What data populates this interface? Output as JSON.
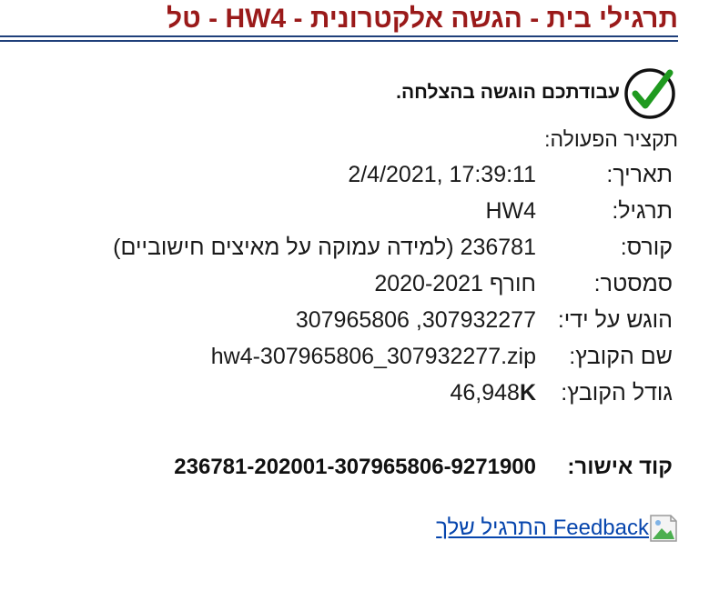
{
  "header": {
    "title": "תרגילי בית - הגשה אלקטרונית - HW4 - טל"
  },
  "success": {
    "icon": "check-circle-icon",
    "message": "עבודתכם הוגשה בהצלחה."
  },
  "summary": {
    "title": "תקציר הפעולה:",
    "rows": [
      {
        "label": "תאריך:",
        "value": "2/4/2021, 17:39:11"
      },
      {
        "label": "תרגיל:",
        "value": "HW4"
      },
      {
        "label": "קורס:",
        "value": "236781 (למידה עמוקה על מאיצים חישוביים)"
      },
      {
        "label": "סמסטר:",
        "value": "חורף 2020-2021"
      },
      {
        "label": "הוגש על ידי:",
        "value": "307965806 ,307932277"
      },
      {
        "label": "שם הקובץ:",
        "value": "hw4-307965806_307932277.zip"
      }
    ],
    "file_size": {
      "label": "גודל הקובץ:",
      "value": "46,948",
      "unit": "K"
    }
  },
  "approval": {
    "label": "קוד אישור:",
    "code": "236781-202001-307965806-9271900"
  },
  "feedback": {
    "icon": "broken-image-icon",
    "link_text": "Feedback התרגיל שלך"
  },
  "colors": {
    "title": "#9a1a1a",
    "rule": "#1f3f7a",
    "link": "#0645ad",
    "check": "#1f9a1f"
  }
}
